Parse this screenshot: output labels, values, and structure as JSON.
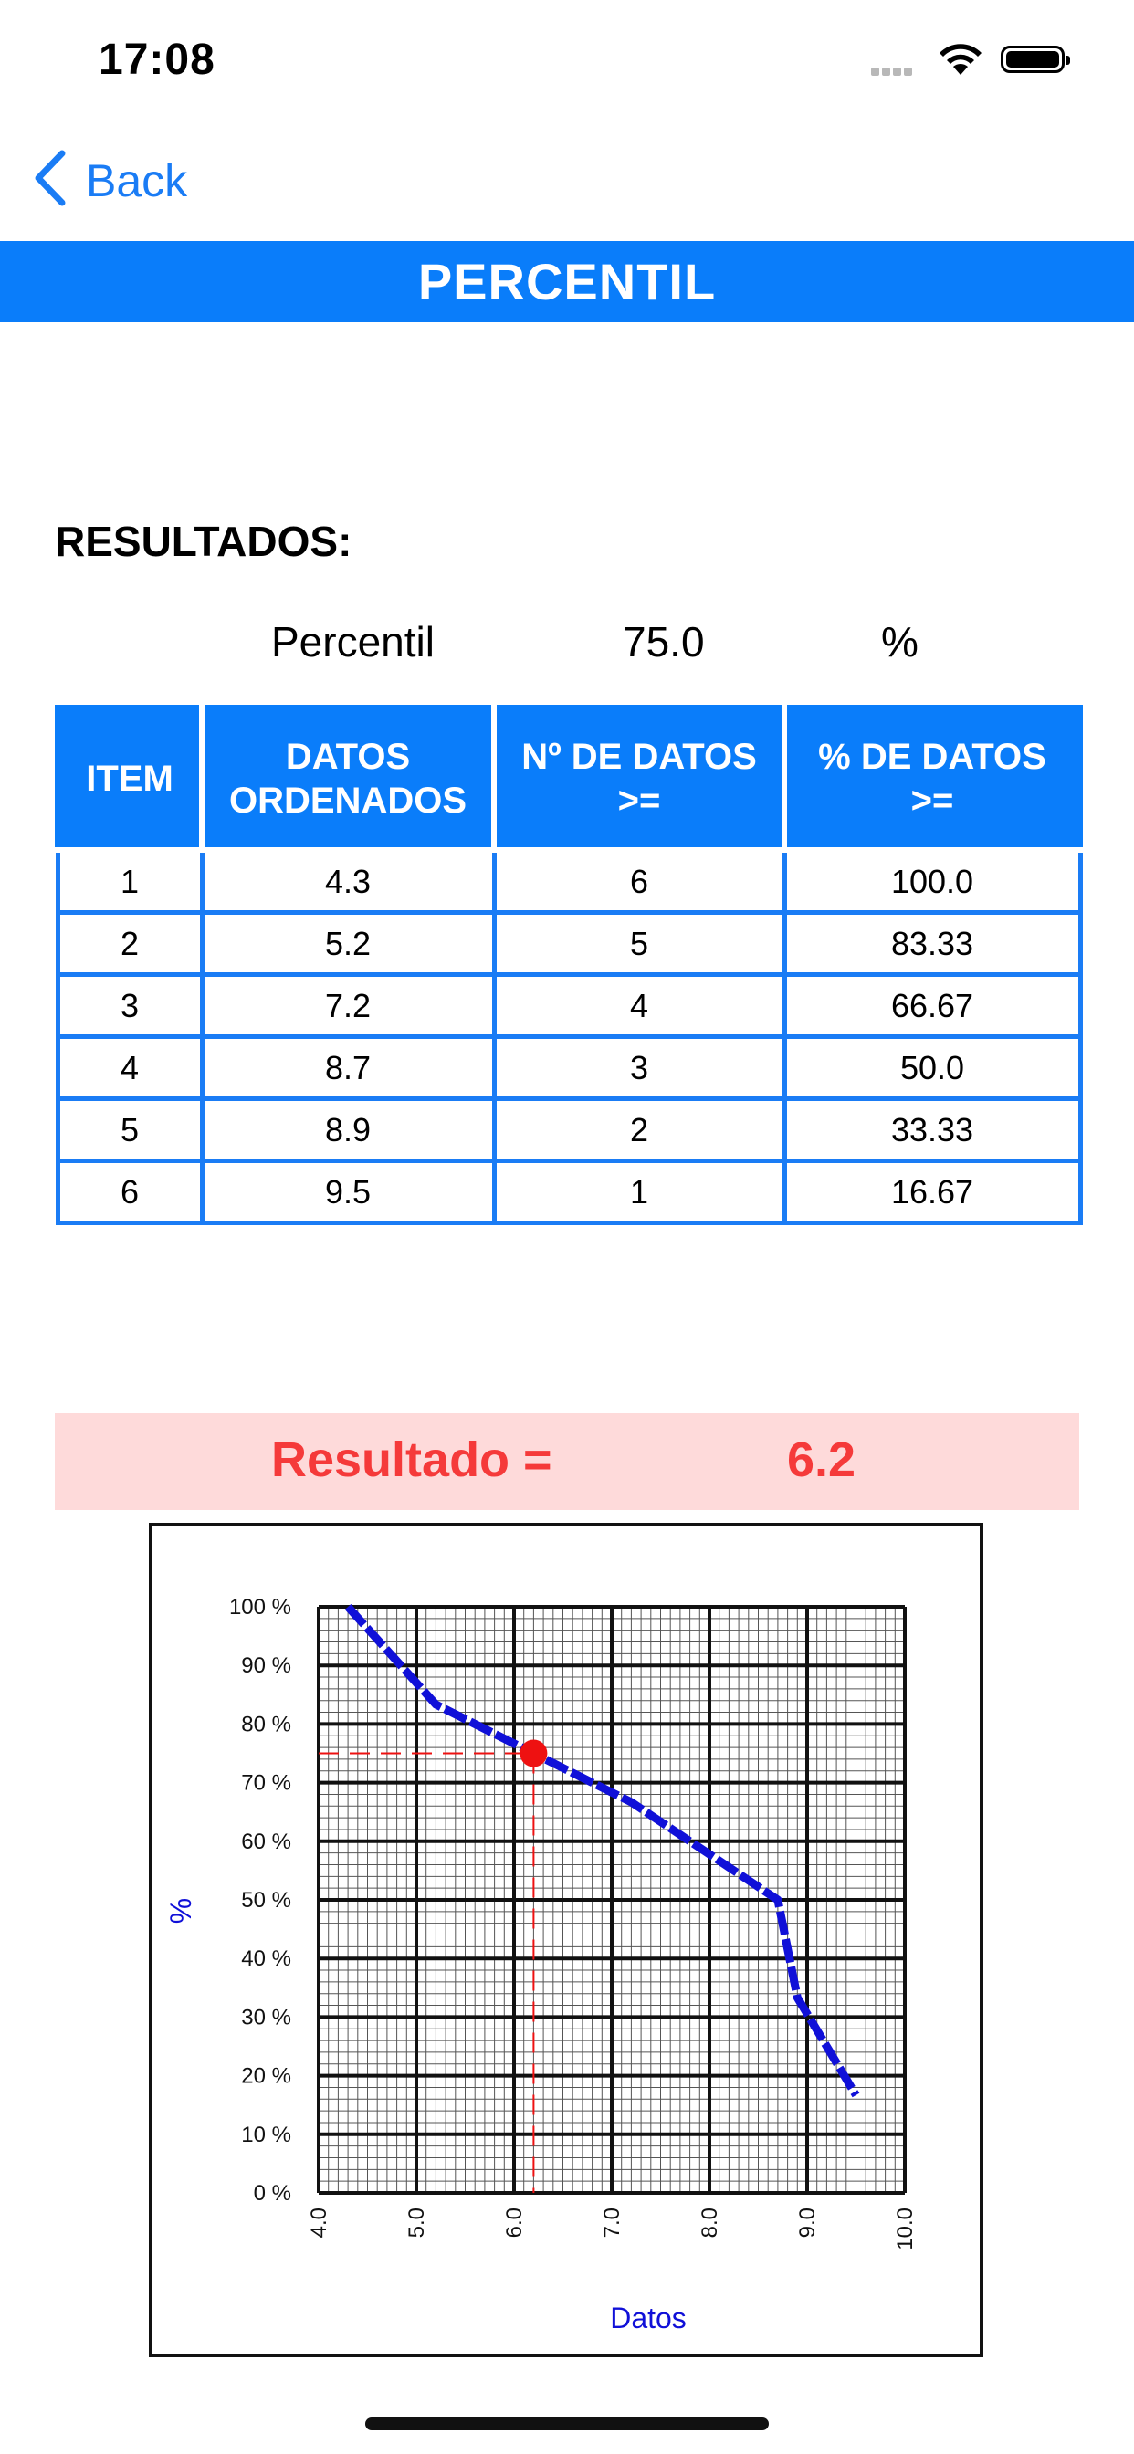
{
  "status_bar": {
    "time": "17:08"
  },
  "nav": {
    "back_label": "Back"
  },
  "header": {
    "title": "PERCENTIL"
  },
  "results": {
    "heading": "RESULTADOS:",
    "percentile_label": "Percentil",
    "percentile_value": "75.0",
    "percentile_unit": "%"
  },
  "table": {
    "headers": [
      "ITEM",
      "DATOS ORDENADOS",
      "Nº DE DATOS >=",
      "% DE DATOS >="
    ],
    "rows": [
      [
        "1",
        "4.3",
        "6",
        "100.0"
      ],
      [
        "2",
        "5.2",
        "5",
        "83.33"
      ],
      [
        "3",
        "7.2",
        "4",
        "66.67"
      ],
      [
        "4",
        "8.7",
        "3",
        "50.0"
      ],
      [
        "5",
        "8.9",
        "2",
        "33.33"
      ],
      [
        "6",
        "9.5",
        "1",
        "16.67"
      ]
    ]
  },
  "resultado": {
    "label": "Resultado =",
    "value": "6.2"
  },
  "colors": {
    "accent": "#0a7dfa",
    "result_red": "#f53a3a",
    "result_bg": "#fedada",
    "line_blue": "#1010d8",
    "marker_red": "#ee1111"
  },
  "chart_data": {
    "type": "line",
    "xlabel": "Datos",
    "ylabel": "%",
    "xlim": [
      4.0,
      10.0
    ],
    "ylim": [
      0,
      100
    ],
    "x_ticks": [
      "4.0",
      "5.0",
      "6.0",
      "7.0",
      "8.0",
      "9.0",
      "10.0"
    ],
    "y_ticks": [
      "0 %",
      "10 %",
      "20 %",
      "30 %",
      "40 %",
      "50 %",
      "60 %",
      "70 %",
      "80 %",
      "90 %",
      "100 %"
    ],
    "grid": true,
    "series": [
      {
        "x": [
          4.3,
          5.2,
          7.2,
          8.7,
          8.9,
          9.5
        ],
        "y": [
          100.0,
          83.33,
          66.67,
          50.0,
          33.33,
          16.67
        ]
      }
    ],
    "marker": {
      "x": 6.2,
      "y": 75.0
    }
  }
}
